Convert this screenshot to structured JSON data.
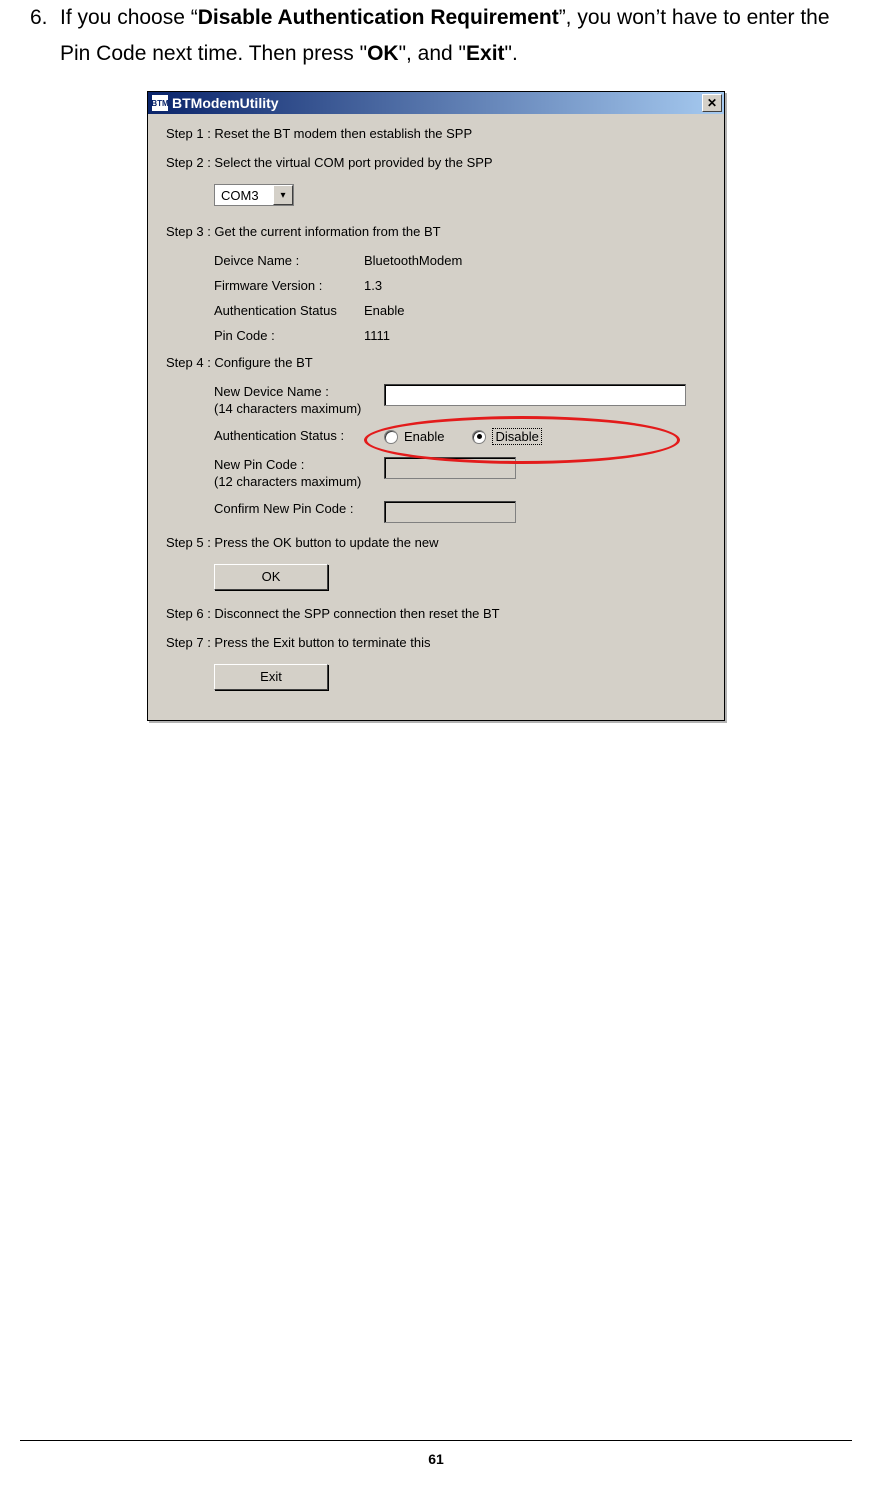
{
  "instruction": {
    "number": "6.",
    "text_pre": "If you choose “",
    "bold1": "Disable Authentication Requirement",
    "text_mid1": "”, you won’t have to enter the Pin Code next time. Then press \"",
    "bold2": "OK",
    "text_mid2": "\", and \"",
    "bold3": "Exit",
    "text_post": "\"."
  },
  "window": {
    "title": "BTModemUtility",
    "icon_text": "BTM",
    "close_glyph": "✕"
  },
  "steps": {
    "s1": "Step 1 : Reset the BT modem then establish the SPP",
    "s2": "Step 2 : Select the virtual COM port provided by the SPP",
    "com_value": "COM3",
    "combo_arrow": "▾",
    "s3": "Step 3 : Get the current information from the BT",
    "s3_rows": {
      "name_label": "Deivce Name :",
      "name_value": "BluetoothModem",
      "fw_label": "Firmware Version :",
      "fw_value": "1.3",
      "auth_label": "Authentication Status",
      "auth_value": "Enable",
      "pin_label": "Pin Code :",
      "pin_value": "1111"
    },
    "s4": "Step 4 : Configure the BT",
    "s4_rows": {
      "new_name_label": "New Device Name :\n(14 characters maximum)",
      "auth_label": "Authentication Status :",
      "radio_enable": "Enable",
      "radio_disable": "Disable",
      "new_pin_label": "New Pin Code :\n(12 characters maximum)",
      "confirm_pin_label": "Confirm New Pin Code :"
    },
    "s5": "Step 5 : Press the OK button to update the new",
    "ok_btn": "OK",
    "s6": "Step 6 : Disconnect the SPP connection then reset the BT",
    "s7": "Step 7 : Press the Exit button to terminate this",
    "exit_btn": "Exit"
  },
  "page_number": "61"
}
